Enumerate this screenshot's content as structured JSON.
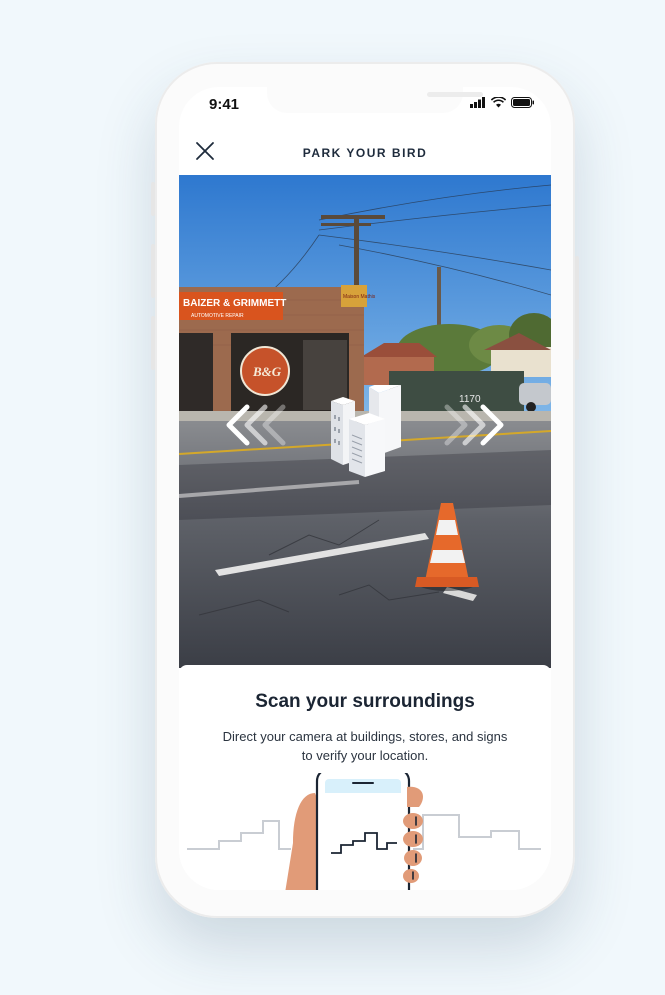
{
  "status_bar": {
    "time": "9:41",
    "icons": [
      "signal-icon",
      "wifi-icon",
      "battery-icon"
    ]
  },
  "header": {
    "title": "PARK YOUR BIRD",
    "close_icon": "close-icon"
  },
  "camera_view": {
    "storefront_sign": "BAIZER & GRIMMETT",
    "storefront_subsign": "AUTOMOTIVE REPAIR",
    "round_logo_text": "B&G",
    "pole_sign": "Maison Mathis",
    "street_number": "1170",
    "overlay_icon": "buildings-icon"
  },
  "instruction_card": {
    "title": "Scan your surroundings",
    "body": "Direct your camera at buildings, stores, and signs to verify your location."
  },
  "colors": {
    "background": "#f1f8fc",
    "title_text": "#1b2533",
    "phone_frame": "#fbfbfb",
    "sky": "#3b86d6"
  }
}
